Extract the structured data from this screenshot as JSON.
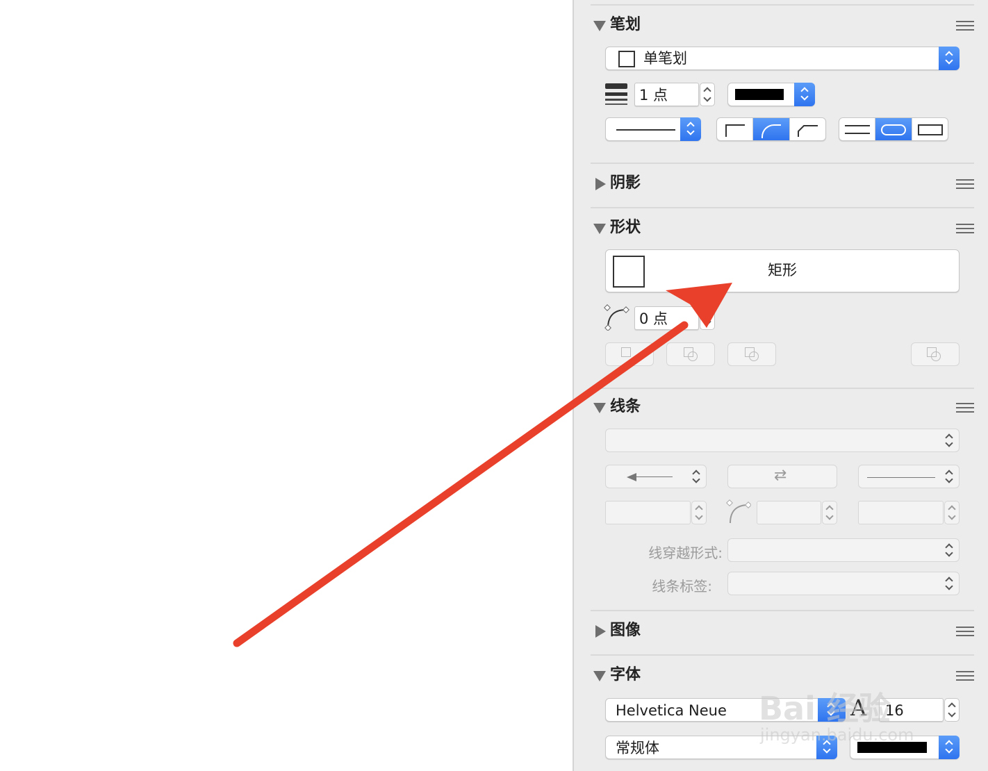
{
  "sections": {
    "stroke": {
      "title": "笔划",
      "style_value": "单笔划",
      "width_value": "1 点",
      "color": "#000000"
    },
    "shadow": {
      "title": "阴影"
    },
    "shape": {
      "title": "形状",
      "shape_name": "矩形",
      "corner_value": "0 点"
    },
    "line": {
      "title": "线条",
      "crossing_label": "线穿越形式:",
      "label_label": "线条标签:"
    },
    "image": {
      "title": "图像"
    },
    "font": {
      "title": "字体",
      "family": "Helvetica Neue",
      "size": "16",
      "style": "常规体",
      "color": "#000000"
    }
  },
  "annotation": {
    "arrow_color": "#e8402a"
  },
  "watermark": {
    "line1": "Bai 经验",
    "line2": "jingyan.baidu.com"
  },
  "colors": {
    "accent": "#3478f6",
    "panel_bg": "#ececec"
  }
}
